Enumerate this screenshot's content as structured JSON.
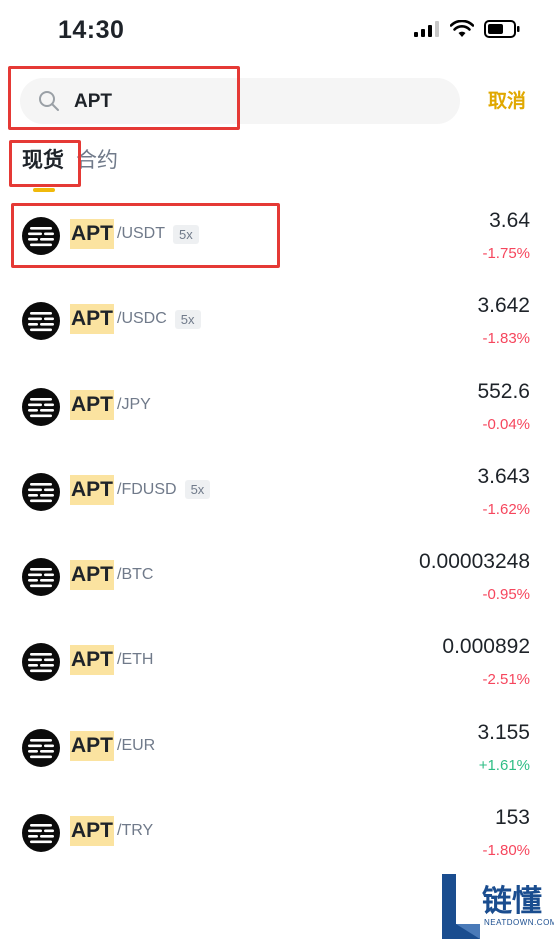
{
  "status_bar": {
    "time": "14:30"
  },
  "search": {
    "query": "APT",
    "cancel_label": "取消"
  },
  "tabs": [
    {
      "label": "现货",
      "active": true
    },
    {
      "label": "合约",
      "active": false
    }
  ],
  "pairs": [
    {
      "base": "APT",
      "quote": "/USDT",
      "leverage": "5x",
      "price": "3.64",
      "change": "-1.75%",
      "direction": "down"
    },
    {
      "base": "APT",
      "quote": "/USDC",
      "leverage": "5x",
      "price": "3.642",
      "change": "-1.83%",
      "direction": "down"
    },
    {
      "base": "APT",
      "quote": "/JPY",
      "leverage": "",
      "price": "552.6",
      "change": "-0.04%",
      "direction": "down"
    },
    {
      "base": "APT",
      "quote": "/FDUSD",
      "leverage": "5x",
      "price": "3.643",
      "change": "-1.62%",
      "direction": "down"
    },
    {
      "base": "APT",
      "quote": "/BTC",
      "leverage": "",
      "price": "0.00003248",
      "change": "-0.95%",
      "direction": "down"
    },
    {
      "base": "APT",
      "quote": "/ETH",
      "leverage": "",
      "price": "0.000892",
      "change": "-2.51%",
      "direction": "down"
    },
    {
      "base": "APT",
      "quote": "/EUR",
      "leverage": "",
      "price": "3.155",
      "change": "+1.61%",
      "direction": "up"
    },
    {
      "base": "APT",
      "quote": "/TRY",
      "leverage": "",
      "price": "153",
      "change": "-1.80%",
      "direction": "down"
    }
  ],
  "colors": {
    "accent": "#f0b90b",
    "negative": "#f6465d",
    "positive": "#2ebd85",
    "highlight": "#fbe3a0",
    "annotation": "#e53935"
  },
  "watermark": {
    "title": "链懂",
    "subtitle": "NEATDOWN.COM"
  }
}
